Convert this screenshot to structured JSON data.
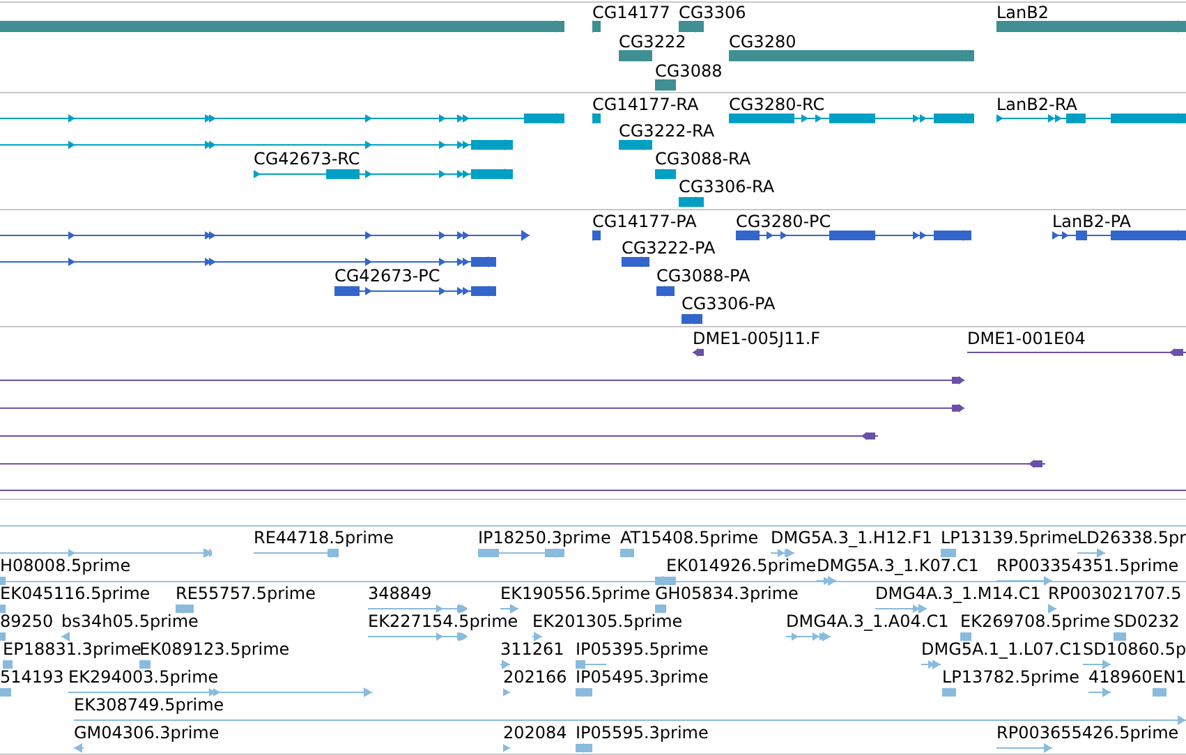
{
  "tracks": [
    {
      "kind": "gene",
      "features": [
        {
          "kind": "forward"
        },
        {
          "label": "CG14177",
          "kind": "forward"
        },
        {
          "label": "CG3306",
          "kind": "forward"
        },
        {
          "label": "CG3222",
          "kind": "forward"
        },
        {
          "label": "CG3280",
          "kind": "forward"
        },
        {
          "label": "CG3088",
          "kind": "reverse"
        },
        {
          "label": "LanB2",
          "kind": "forward"
        }
      ]
    },
    {
      "kind": "transcript",
      "features": [
        {
          "kind": "forward"
        },
        {
          "kind": "forward"
        },
        {
          "label": "CG42673-RC",
          "kind": "forward"
        },
        {
          "label": "CG14177-RA",
          "kind": "forward"
        },
        {
          "label": "CG3280-RC",
          "kind": "forward"
        },
        {
          "label": "LanB2-RA",
          "kind": "forward"
        },
        {
          "label": "CG3222-RA",
          "kind": "forward"
        },
        {
          "label": "CG3088-RA",
          "kind": "reverse"
        },
        {
          "label": "CG3306-RA",
          "kind": "forward"
        }
      ]
    },
    {
      "kind": "cds",
      "features": [
        {
          "kind": "forward"
        },
        {
          "kind": "forward"
        },
        {
          "label": "CG42673-PC",
          "kind": "forward"
        },
        {
          "label": "CG14177-PA",
          "kind": "forward"
        },
        {
          "label": "CG3280-PC",
          "kind": "forward"
        },
        {
          "label": "LanB2-PA",
          "kind": "forward"
        },
        {
          "label": "CG3222-PA",
          "kind": "forward"
        },
        {
          "label": "CG3088-PA",
          "kind": "reverse"
        },
        {
          "label": "CG3306-PA",
          "kind": "forward"
        }
      ]
    },
    {
      "kind": "clone",
      "features": [
        {
          "label": "DME1-005J11.F",
          "kind": "reverse"
        },
        {
          "label": "DME1-001E04",
          "kind": "reverse"
        },
        {
          "kind": "forward"
        },
        {
          "kind": "forward"
        },
        {
          "kind": "reverse"
        },
        {
          "kind": "reverse"
        },
        {
          "kind": "line"
        }
      ]
    },
    {
      "kind": "est",
      "features": [
        {
          "kind": "forward"
        },
        {
          "label": "RE44718.5prime",
          "kind": "forward"
        },
        {
          "label": "IP18250.3prime",
          "kind": "forward"
        },
        {
          "label": "AT15408.5prime",
          "kind": "forward"
        },
        {
          "label": "DMG5A.3_1.H12.F1",
          "kind": "forward"
        },
        {
          "label": "LP13139.5prime",
          "kind": "reverse"
        },
        {
          "label": "LD26338.5pr",
          "kind": "forward"
        },
        {
          "label": "H08008.5prime",
          "kind": "forward"
        },
        {
          "label": "EK014926.5prime",
          "kind": "reverse"
        },
        {
          "label": "DMG5A.3_1.K07.C1",
          "kind": "forward"
        },
        {
          "label": "RP003354351.5prime",
          "kind": "forward"
        },
        {
          "label": "EK045116.5prime",
          "kind": "forward"
        },
        {
          "label": "RE55757.5prime",
          "kind": "reverse"
        },
        {
          "label": "348849",
          "kind": "forward"
        },
        {
          "label": "EK190556.5prime",
          "kind": "forward"
        },
        {
          "label": "GH05834.3prime",
          "kind": "reverse"
        },
        {
          "label": "DMG4A.3_1.M14.C1",
          "kind": "forward"
        },
        {
          "label": "RP003021707.5",
          "kind": "forward"
        },
        {
          "label": "89250",
          "kind": "forward"
        },
        {
          "label": "bs34h05.5prime",
          "kind": "reverse"
        },
        {
          "label": "EK227154.5prime",
          "kind": "forward"
        },
        {
          "label": "EK201305.5prime",
          "kind": "forward"
        },
        {
          "label": "DMG4A.3_1.A04.C1",
          "kind": "forward"
        },
        {
          "label": "EK269708.5prime",
          "kind": "forward"
        },
        {
          "label": "SD0232",
          "kind": "forward"
        },
        {
          "label": "EP18831.3prime",
          "kind": "forward"
        },
        {
          "label": "EK089123.5prime",
          "kind": "forward"
        },
        {
          "label": "311261",
          "kind": "forward"
        },
        {
          "label": "IP05395.5prime",
          "kind": "reverse"
        },
        {
          "label": "DMG5A.1_1.L07.C1",
          "kind": "forward"
        },
        {
          "label": "SD10860.5p",
          "kind": "forward"
        },
        {
          "label": "514193",
          "kind": "reverse"
        },
        {
          "label": "EK294003.5prime",
          "kind": "forward"
        },
        {
          "label": "202166",
          "kind": "forward"
        },
        {
          "label": "IP05495.3prime",
          "kind": "reverse"
        },
        {
          "label": "LP13782.5prime",
          "kind": "reverse"
        },
        {
          "label": "418960",
          "kind": "forward"
        },
        {
          "label": "EN1",
          "kind": "forward"
        },
        {
          "label": "EK308749.5prime",
          "kind": "forward"
        },
        {
          "label": "GM04306.3prime",
          "kind": "reverse"
        },
        {
          "label": "202084",
          "kind": "forward"
        },
        {
          "label": "IP05595.3prime",
          "kind": "reverse"
        },
        {
          "label": "RP003655426.5prime",
          "kind": "forward"
        }
      ]
    }
  ]
}
